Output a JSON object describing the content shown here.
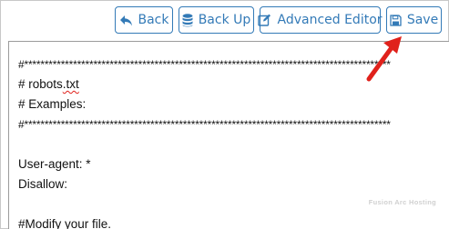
{
  "toolbar": {
    "back_label": "Back",
    "backup_label": "Back Up",
    "advanced_editor_label": "Advanced Editor",
    "save_label": "Save"
  },
  "editor": {
    "lines": [
      "#******************************************************************************************",
      "# robots",
      ".txt",
      "# Examples:",
      "#******************************************************************************************",
      "",
      "User-agent: *",
      "Disallow:",
      "",
      "#Modify your file."
    ]
  },
  "watermark": "Fusion Arc Hosting",
  "colors": {
    "accent": "#337ab7",
    "annotation_arrow": "#e0211b"
  },
  "icons": {
    "back": "reply-arrow-icon",
    "backup": "database-icon",
    "advanced_editor": "edit-square-icon",
    "save": "floppy-disk-icon"
  }
}
